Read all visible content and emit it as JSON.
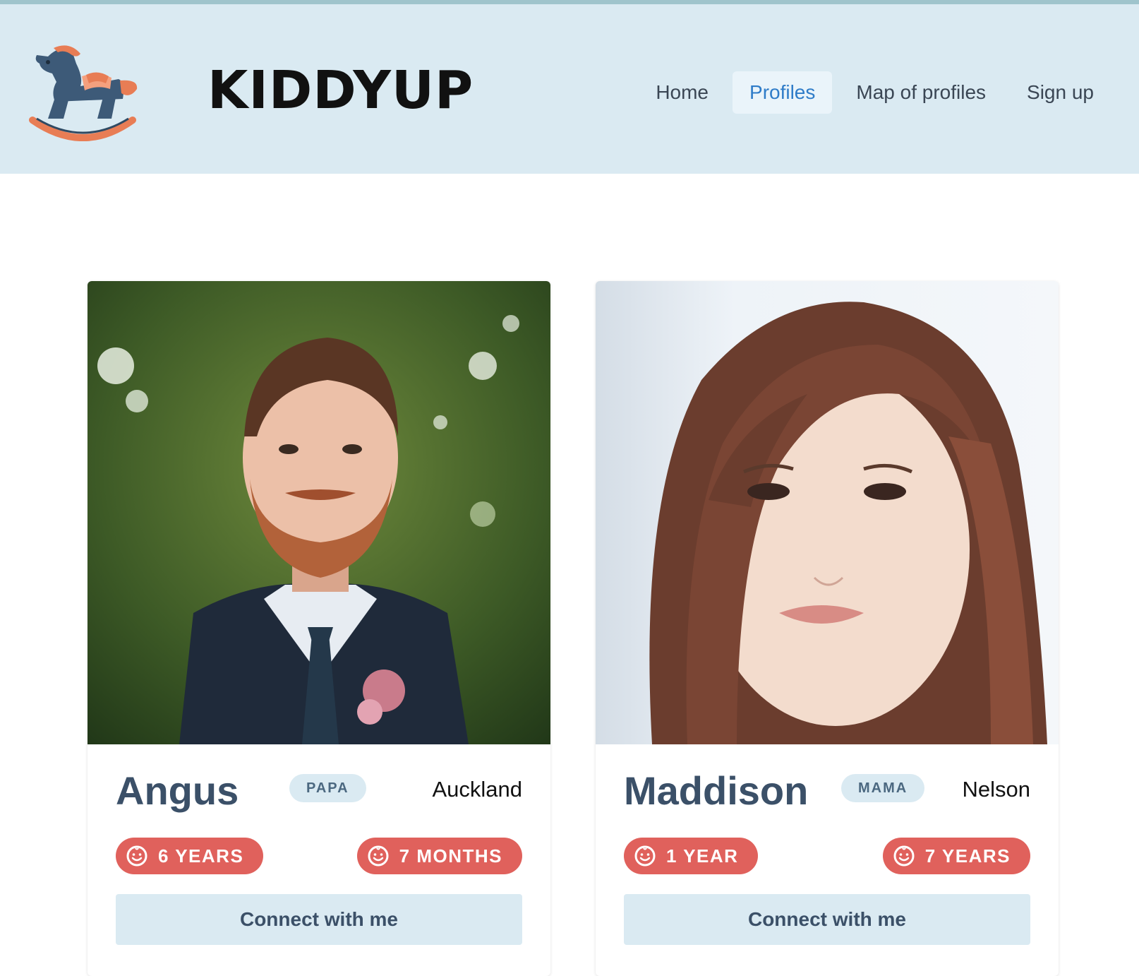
{
  "header": {
    "brand": "KIDDYUP",
    "nav": [
      {
        "label": "Home",
        "active": false
      },
      {
        "label": "Profiles",
        "active": true
      },
      {
        "label": "Map of profiles",
        "active": false
      },
      {
        "label": "Sign up",
        "active": false
      }
    ]
  },
  "profiles": [
    {
      "name": "Angus",
      "role": "PAPA",
      "city": "Auckland",
      "kids": [
        "6 YEARS",
        "7 MONTHS"
      ],
      "button": "Connect with me"
    },
    {
      "name": "Maddison",
      "role": "MAMA",
      "city": "Nelson",
      "kids": [
        "1 YEAR",
        "7 YEARS"
      ],
      "button": "Connect with me"
    }
  ],
  "colors": {
    "header_bg": "#daeaf2",
    "accent": "#2f7cc8",
    "badge_red": "#e0615c",
    "name_text": "#3b5068"
  },
  "icons": {
    "logo": "rocking-horse-icon",
    "age": "baby-face-icon"
  }
}
